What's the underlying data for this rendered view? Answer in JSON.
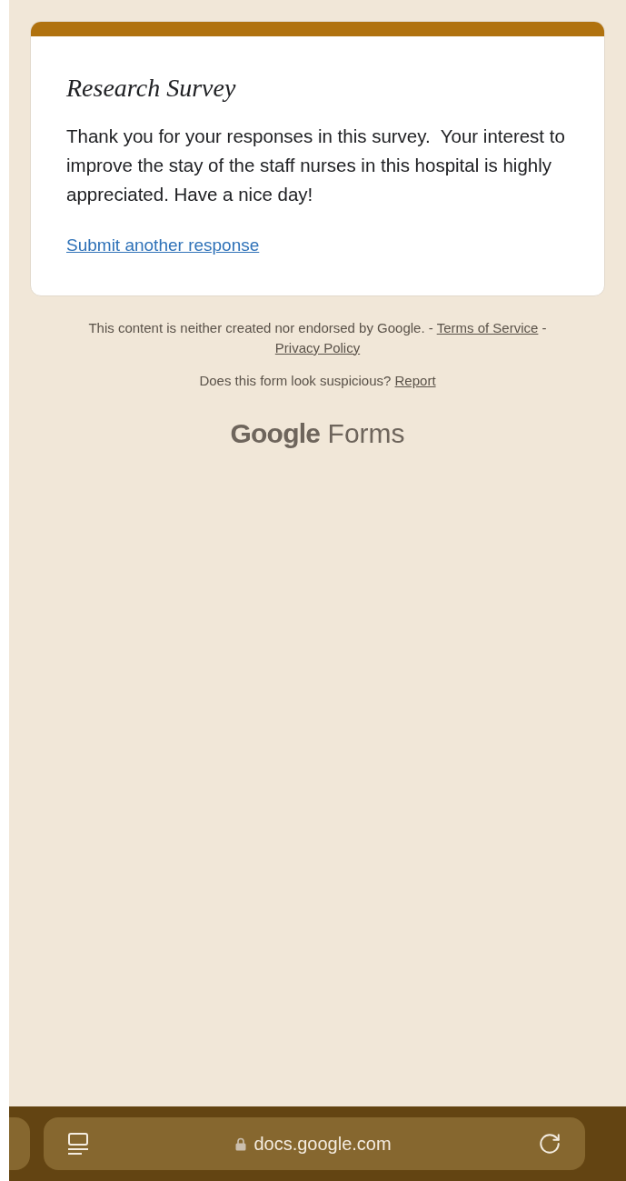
{
  "card": {
    "title": "Research Survey",
    "message": "Thank you for your responses in this survey.  Your interest to improve the stay of the staff nurses in this hospital is highly appreciated. Have a nice day!",
    "link": "Submit another response"
  },
  "footer": {
    "disclaimer": [
      {
        "kind": "text",
        "text": "This content is neither created nor endorsed by Google. - "
      },
      {
        "kind": "link",
        "text": "Terms of Service"
      },
      {
        "kind": "text",
        "text": " - "
      },
      {
        "kind": "link",
        "text": "Privacy Policy"
      }
    ],
    "report": [
      {
        "kind": "text",
        "text": "Does this form look suspicious? "
      },
      {
        "kind": "link",
        "text": "Report"
      }
    ]
  },
  "logo": {
    "brand": "Google",
    "product": "Forms"
  },
  "browser_bar": {
    "url": "docs.google.com"
  }
}
